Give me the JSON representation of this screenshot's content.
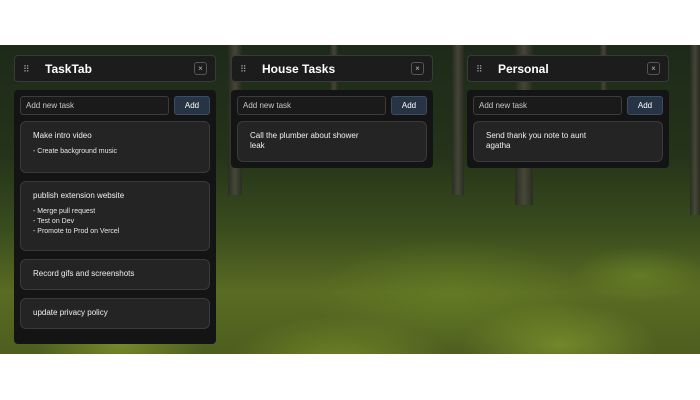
{
  "columns": [
    {
      "title": "TaskTab",
      "input_placeholder": "Add new task",
      "add_label": "Add",
      "close_label": "×",
      "tasks": [
        {
          "title": "Make intro video",
          "notes": "- Create background music"
        },
        {
          "title": "publish extension website",
          "notes": "- Merge pull request\n- Test on Dev\n- Promote to Prod on Vercel"
        },
        {
          "title": "Record gifs and screenshots",
          "notes": ""
        },
        {
          "title": "update privacy policy",
          "notes": ""
        }
      ]
    },
    {
      "title": "House Tasks",
      "input_placeholder": "Add new task",
      "add_label": "Add",
      "close_label": "×",
      "tasks": [
        {
          "title": "Call the plumber about shower leak",
          "notes": ""
        }
      ]
    },
    {
      "title": "Personal",
      "input_placeholder": "Add new task",
      "add_label": "Add",
      "close_label": "×",
      "tasks": [
        {
          "title": "Send thank you note to aunt agatha",
          "notes": ""
        }
      ]
    }
  ],
  "colors": {
    "panel": "#141414",
    "card": "#242424",
    "add_button": "#263445"
  }
}
